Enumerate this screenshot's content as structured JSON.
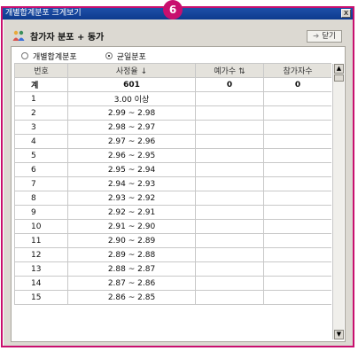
{
  "callout": "6",
  "window": {
    "title": "개별합계분포 크게보기",
    "close_glyph": "x"
  },
  "header": {
    "title": "참가자 분포 + 동가",
    "close_label": "닫기"
  },
  "radios": [
    {
      "label": "개별합계분포",
      "selected": false
    },
    {
      "label": "균일분포",
      "selected": true
    }
  ],
  "table": {
    "columns": [
      "번호",
      "사정율 ↓",
      "예가수 ⇅",
      "참가자수"
    ],
    "total": {
      "no": "계",
      "rate": "601",
      "count": "0",
      "participants": "0"
    },
    "rows": [
      {
        "no": "1",
        "rate": "3.00 이상"
      },
      {
        "no": "2",
        "rate": "2.99 ~ 2.98"
      },
      {
        "no": "3",
        "rate": "2.98 ~ 2.97"
      },
      {
        "no": "4",
        "rate": "2.97 ~ 2.96"
      },
      {
        "no": "5",
        "rate": "2.96 ~ 2.95"
      },
      {
        "no": "6",
        "rate": "2.95 ~ 2.94"
      },
      {
        "no": "7",
        "rate": "2.94 ~ 2.93"
      },
      {
        "no": "8",
        "rate": "2.93 ~ 2.92"
      },
      {
        "no": "9",
        "rate": "2.92 ~ 2.91"
      },
      {
        "no": "10",
        "rate": "2.91 ~ 2.90"
      },
      {
        "no": "11",
        "rate": "2.90 ~ 2.89"
      },
      {
        "no": "12",
        "rate": "2.89 ~ 2.88"
      },
      {
        "no": "13",
        "rate": "2.88 ~ 2.87"
      },
      {
        "no": "14",
        "rate": "2.87 ~ 2.86"
      },
      {
        "no": "15",
        "rate": "2.86 ~ 2.85"
      }
    ]
  },
  "colors": {
    "accent": "#c80f6e",
    "titlebar": "#0d3a8e",
    "chrome": "#dcd9d2"
  }
}
